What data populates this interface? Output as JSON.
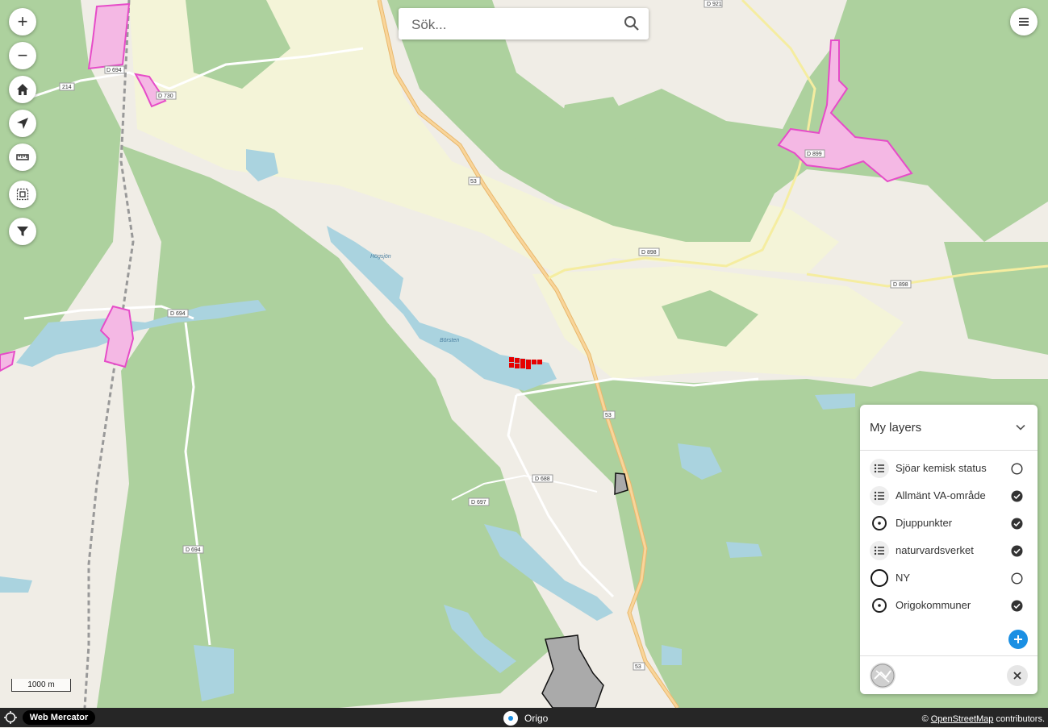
{
  "search": {
    "placeholder": "Sök..."
  },
  "map": {
    "labels": {
      "road_d921": "D 921",
      "road_214": "214",
      "road_d694_top": "D 694",
      "road_d730": "D 730",
      "road_53_a": "53",
      "road_d899": "D 899",
      "road_d898_a": "D 898",
      "road_d898_b": "D 898",
      "road_d694_mid": "D 694",
      "road_53_b": "53",
      "road_d688": "D 688",
      "road_d697": "D 697",
      "road_d694_low": "D 694",
      "road_53_c": "53",
      "lake_borsten": "Börsten",
      "lake_hogsjon": "Högsjön"
    }
  },
  "toolbar": {
    "zoom_in": "+",
    "zoom_out": "−"
  },
  "layers_panel": {
    "title": "My layers",
    "items": [
      {
        "label": "Sjöar kemisk status",
        "checked": false
      },
      {
        "label": "Allmänt VA-område",
        "checked": true
      },
      {
        "label": "Djuppunkter",
        "checked": true
      },
      {
        "label": "naturvardsverket",
        "checked": true
      },
      {
        "label": "NY",
        "checked": false
      },
      {
        "label": "Origokommuner",
        "checked": true
      }
    ]
  },
  "scale": {
    "label": "1000 m"
  },
  "footer": {
    "projection": "Web Mercator",
    "app_name": "Origo",
    "attribution_prefix": "©",
    "attribution_link": "OpenStreetMap",
    "attribution_suffix": "contributors."
  },
  "colors": {
    "accent": "#1a8fe3",
    "forest": "#a9d18e",
    "water": "#aad3df",
    "pink": "#e64cc8"
  }
}
